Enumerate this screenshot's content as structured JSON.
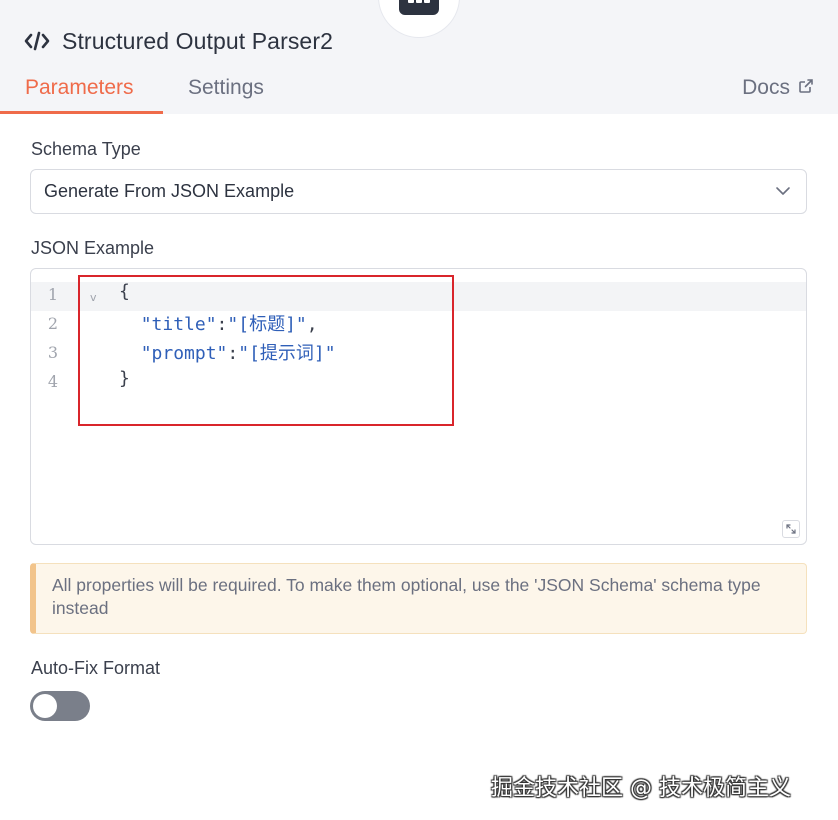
{
  "node": {
    "icon": "robot-icon",
    "title": "Structured Output Parser2"
  },
  "tabs": [
    {
      "label": "Parameters",
      "active": true
    },
    {
      "label": "Settings",
      "active": false
    }
  ],
  "docs_label": "Docs",
  "schema_type": {
    "label": "Schema Type",
    "value": "Generate From JSON Example"
  },
  "json_example": {
    "label": "JSON Example",
    "line_numbers": [
      "1",
      "2",
      "3",
      "4"
    ],
    "lines": [
      {
        "indent": "",
        "parts": [
          {
            "t": "punc",
            "v": "{"
          }
        ]
      },
      {
        "indent": "  ",
        "parts": [
          {
            "t": "key",
            "v": "\"title\""
          },
          {
            "t": "punc",
            "v": ":"
          },
          {
            "t": "str",
            "v": "\"[标题]\""
          },
          {
            "t": "punc",
            "v": ","
          }
        ]
      },
      {
        "indent": "  ",
        "parts": [
          {
            "t": "key",
            "v": "\"prompt\""
          },
          {
            "t": "punc",
            "v": ":"
          },
          {
            "t": "str",
            "v": "\"[提示词]\""
          }
        ]
      },
      {
        "indent": "",
        "parts": [
          {
            "t": "punc",
            "v": "}"
          }
        ]
      }
    ]
  },
  "notice": "All properties will be required. To make them optional, use the 'JSON Schema' schema type instead",
  "auto_fix": {
    "label": "Auto-Fix Format",
    "enabled": false
  },
  "watermark": "掘金技术社区 @ 技术极简主义",
  "colors": {
    "accent": "#ef6b4a",
    "highlight": "#d9252b",
    "notice_border": "#f2c48b"
  }
}
